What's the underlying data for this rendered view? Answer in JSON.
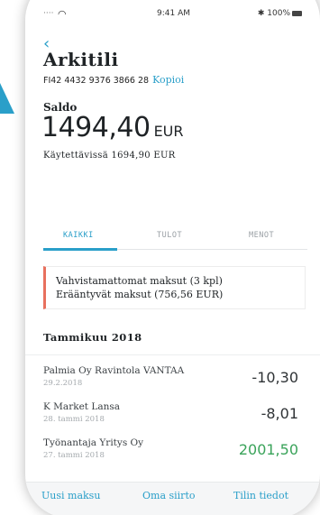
{
  "status_bar": {
    "carrier": "····",
    "time": "9:41 AM",
    "bluetooth_battery": "✱ 100%"
  },
  "header": {
    "back_icon": "chevron-left-icon",
    "title": "Arkitili",
    "iban": "FI42 4432 9376 3866 28",
    "copy_label": "Kopioi"
  },
  "balance": {
    "label": "Saldo",
    "amount": "1494,40",
    "currency": "EUR",
    "available": "Käytettävissä 1694,90 EUR"
  },
  "tabs": [
    {
      "label": "KAIKKI",
      "active": true
    },
    {
      "label": "TULOT",
      "active": false
    },
    {
      "label": "MENOT",
      "active": false
    }
  ],
  "pending": {
    "line1": "Vahvistamattomat maksut (3 kpl)",
    "line2": "Erääntyvät maksut (756,56 EUR)"
  },
  "month_heading": "Tammikuu 2018",
  "transactions": [
    {
      "payee": "Palmia Oy Ravintola VANTAA",
      "date": "29.2.2018",
      "amount": "-10,30",
      "positive": false
    },
    {
      "payee": "K Market Lansa",
      "date": "28. tammi 2018",
      "amount": "-8,01",
      "positive": false
    },
    {
      "payee": "Työnantaja Yritys Oy",
      "date": "27. tammi 2018",
      "amount": "2001,50",
      "positive": true
    }
  ],
  "bottom_actions": [
    "Uusi maksu",
    "Oma siirto",
    "Tilin tiedot"
  ],
  "colors": {
    "accent": "#2a9fc9",
    "positive": "#3aa35a",
    "alert": "#e8705e"
  }
}
